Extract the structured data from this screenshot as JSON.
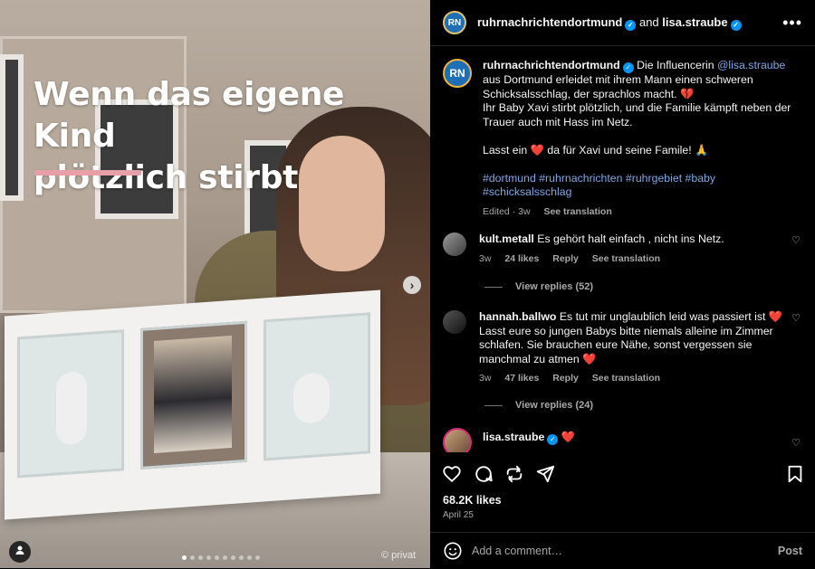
{
  "post": {
    "image": {
      "headline_line1": "Wenn das eigene Kind",
      "headline_line2": "plötzlich stirbt",
      "credit": "© privat",
      "carousel_total": 10,
      "carousel_active": 0
    },
    "header": {
      "author": "ruhrnachrichtendortmund",
      "and": "and",
      "collaborator": "lisa.straube"
    },
    "caption": {
      "username": "ruhrnachrichtendortmund",
      "text1": "Die Influencerin ",
      "mention": "@lisa.straube",
      "text2": " aus Dortmund erleidet mit ihrem Mann einen schweren Schicksalsschlag, der sprachlos macht. 💔",
      "text3": "Ihr Baby Xavi stirbt plötzlich, und die Familie kämpft neben der Trauer auch mit Hass im Netz.",
      "text4": "Lasst ein ❤️ da für Xavi und seine Famile! 🙏",
      "hashtags1": "#dortmund #ruhrnachrichten #ruhrgebiet #baby",
      "hashtags2": "#schicksalsschlag",
      "edited": "Edited · 3w",
      "see_translation": "See translation"
    },
    "comments": [
      {
        "username": "kult.metall",
        "text": "Es gehört halt einfach , nicht ins Netz.",
        "age": "3w",
        "likes": "24 likes",
        "reply": "Reply",
        "see_translation": "See translation",
        "view_replies": "View replies (52)"
      },
      {
        "username": "hannah.ballwo",
        "text": "Es tut mir unglaublich leid was passiert ist ❤️ Lasst eure so jungen Babys bitte niemals alleine im Zimmer schlafen. Sie brauchen eure Nähe, sonst vergessen sie manchmal zu atmen ❤️",
        "age": "3w",
        "likes": "47 likes",
        "reply": "Reply",
        "see_translation": "See translation",
        "view_replies": "View replies (24)"
      },
      {
        "username": "lisa.straube",
        "text": "❤️"
      }
    ],
    "likes": "68.2K likes",
    "date": "April 25",
    "add_comment_placeholder": "Add a comment…",
    "post_label": "Post"
  },
  "icons": {
    "verified": "verified-badge-icon",
    "more": "more-options-icon",
    "like": "heart-outline-icon",
    "comment": "comment-icon",
    "repost": "repost-icon",
    "share": "paper-plane-icon",
    "save": "bookmark-icon",
    "emoji": "emoji-icon",
    "next": "chevron-right-icon",
    "user_tag": "user-tag-icon"
  },
  "colors": {
    "link": "#7ea7ea",
    "verified": "#0095f6",
    "background": "#000000"
  }
}
